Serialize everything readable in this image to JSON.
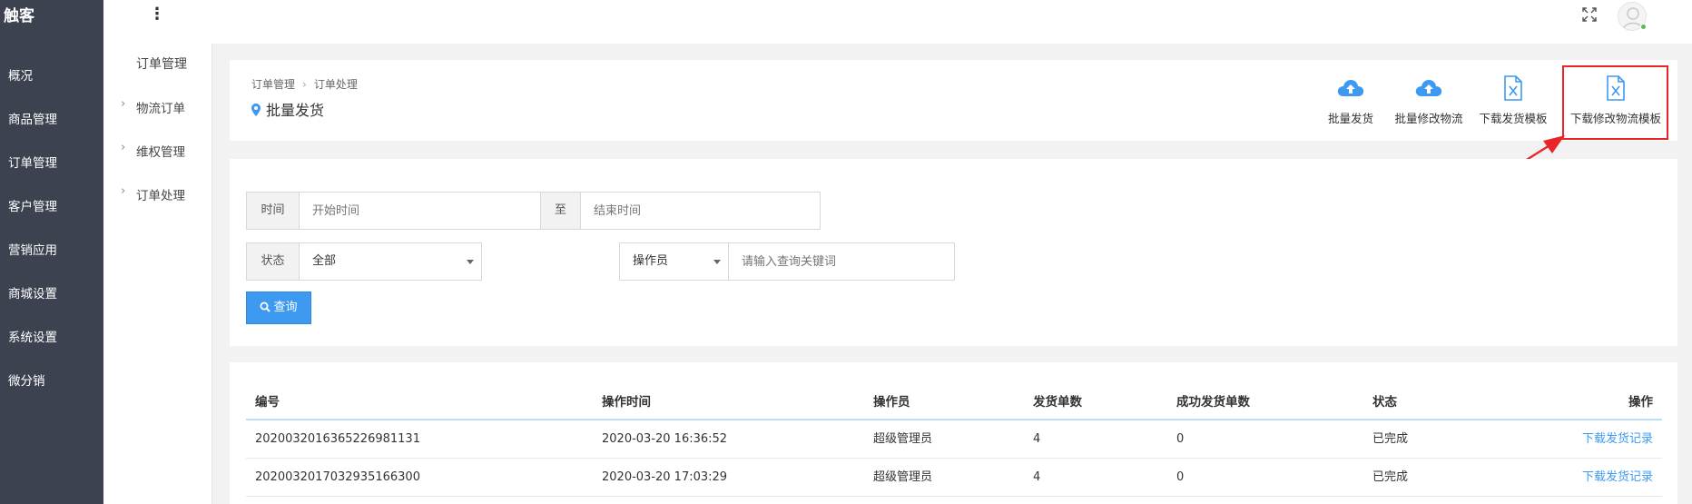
{
  "app": {
    "brand": "触客"
  },
  "main_nav": [
    {
      "label": "概况"
    },
    {
      "label": "商品管理"
    },
    {
      "label": "订单管理"
    },
    {
      "label": "客户管理"
    },
    {
      "label": "营销应用"
    },
    {
      "label": "商城设置"
    },
    {
      "label": "系统设置"
    },
    {
      "label": "微分销"
    }
  ],
  "sub_nav": {
    "title": "订单管理",
    "items": [
      {
        "label": "物流订单"
      },
      {
        "label": "维权管理"
      },
      {
        "label": "订单处理"
      }
    ]
  },
  "topbar": {
    "menu_icon": "vertical-dots-icon",
    "fullscreen_icon": "fullscreen-icon",
    "avatar_icon": "user-avatar-icon",
    "online_color": "#5cb85c"
  },
  "breadcrumb": {
    "items": [
      "订单管理",
      "订单处理"
    ],
    "separator": "›"
  },
  "page": {
    "title": "批量发货",
    "title_icon": "location-pin-icon"
  },
  "toolbar": {
    "batch_ship": {
      "label": "批量发货",
      "icon": "cloud-upload-icon"
    },
    "batch_update_logistics": {
      "label": "批量修改物流",
      "icon": "cloud-upload-icon"
    },
    "download_ship_template": {
      "label": "下载发货模板",
      "icon": "excel-file-icon"
    },
    "download_logistics_template": {
      "label": "下载修改物流模板",
      "icon": "excel-file-icon"
    }
  },
  "filters": {
    "time_label": "时间",
    "start_placeholder": "开始时间",
    "to_label": "至",
    "end_placeholder": "结束时间",
    "status_label": "状态",
    "status_value": "全部",
    "operator_select": "操作员",
    "keyword_placeholder": "请输入查询关键词",
    "query_button": "查询"
  },
  "table": {
    "headers": {
      "id": "编号",
      "time": "操作时间",
      "operator": "操作员",
      "shipped": "发货单数",
      "success": "成功发货单数",
      "status": "状态",
      "action": "操作"
    },
    "rows": [
      {
        "id": "202003201636522698113​1",
        "time": "2020-03-20 16:36:52",
        "operator": "超级管理员",
        "shipped": "4",
        "success": "0",
        "status": "已完成",
        "action": "下载发货记录"
      },
      {
        "id": "20200320170329351663​00",
        "time": "2020-03-20 17:03:29",
        "operator": "超级管理员",
        "shipped": "4",
        "success": "0",
        "status": "已完成",
        "action": "下载发货记录"
      }
    ]
  },
  "colors": {
    "sidebar_bg": "#3d4250",
    "accent": "#3d9af0",
    "highlight": "#e8262a"
  }
}
